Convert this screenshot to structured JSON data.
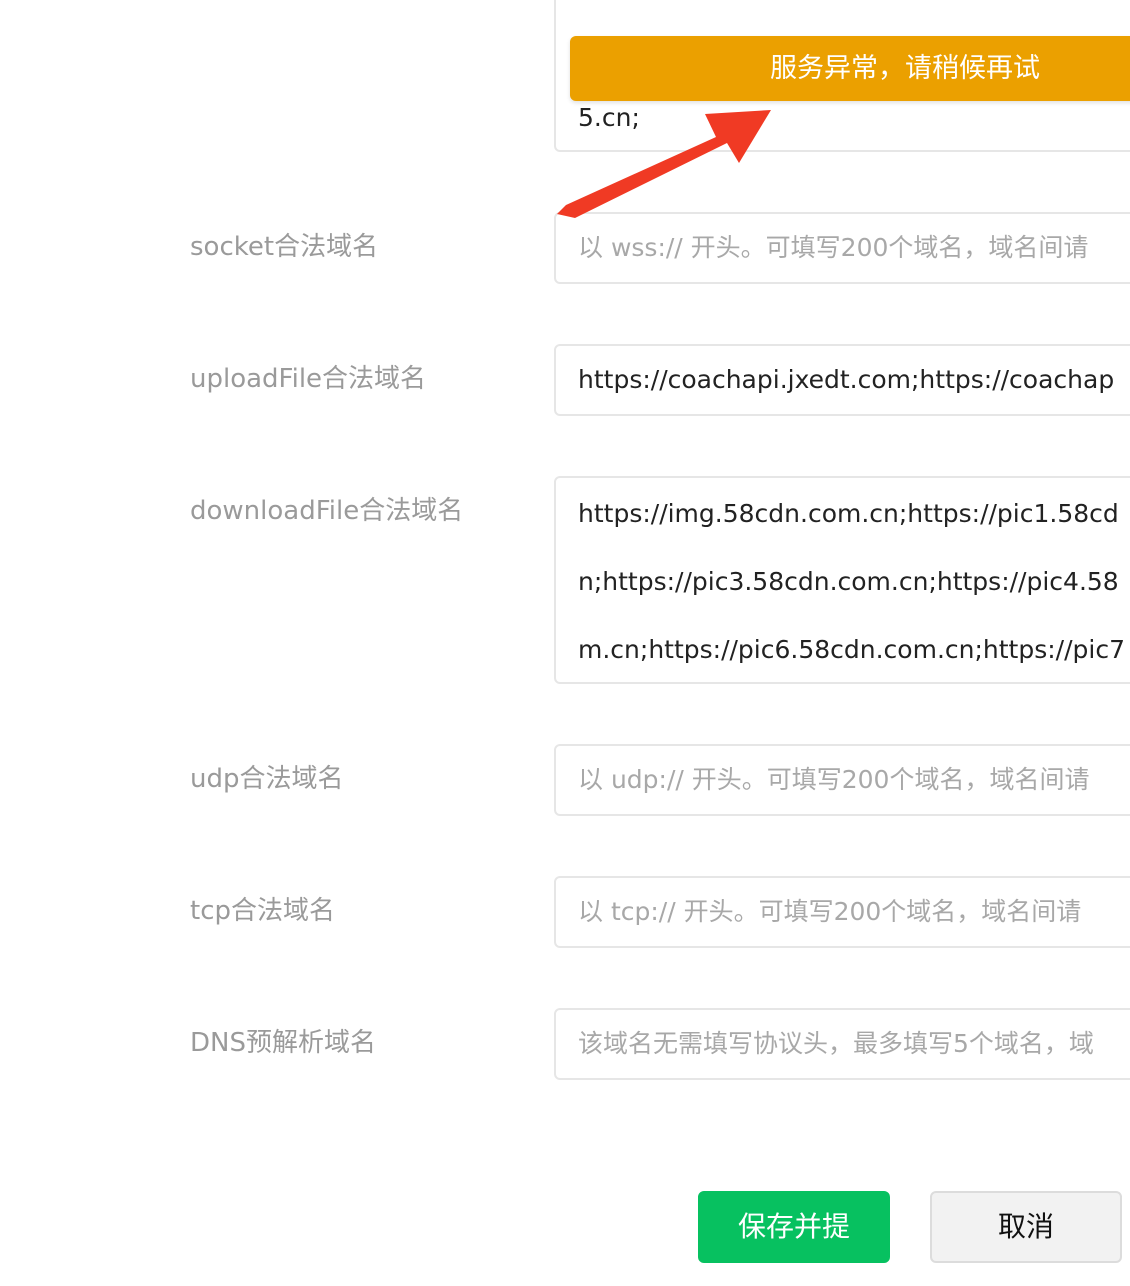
{
  "toast": {
    "message": "服务异常，请稍候再试"
  },
  "fields": {
    "top_partial": {
      "value": "5.cn;"
    },
    "socket": {
      "label": "socket合法域名",
      "placeholder": "以 wss:// 开头。可填写200个域名，域名间请"
    },
    "upload": {
      "label": "uploadFile合法域名",
      "value": "https://coachapi.jxedt.com;https://coachap"
    },
    "download": {
      "label": "downloadFile合法域名",
      "lines": [
        "https://img.58cdn.com.cn;https://pic1.58cd",
        "n;https://pic3.58cdn.com.cn;https://pic4.58",
        "m.cn;https://pic6.58cdn.com.cn;https://pic7"
      ]
    },
    "udp": {
      "label": "udp合法域名",
      "placeholder": "以 udp:// 开头。可填写200个域名，域名间请"
    },
    "tcp": {
      "label": "tcp合法域名",
      "placeholder": "以 tcp:// 开头。可填写200个域名，域名间请"
    },
    "dns": {
      "label": "DNS预解析域名",
      "placeholder": "该域名无需填写协议头，最多填写5个域名，域"
    }
  },
  "buttons": {
    "submit": "保存并提",
    "cancel": "取消"
  },
  "colors": {
    "toast": "#eba000",
    "primary": "#07c160",
    "arrow": "#f03a24"
  }
}
